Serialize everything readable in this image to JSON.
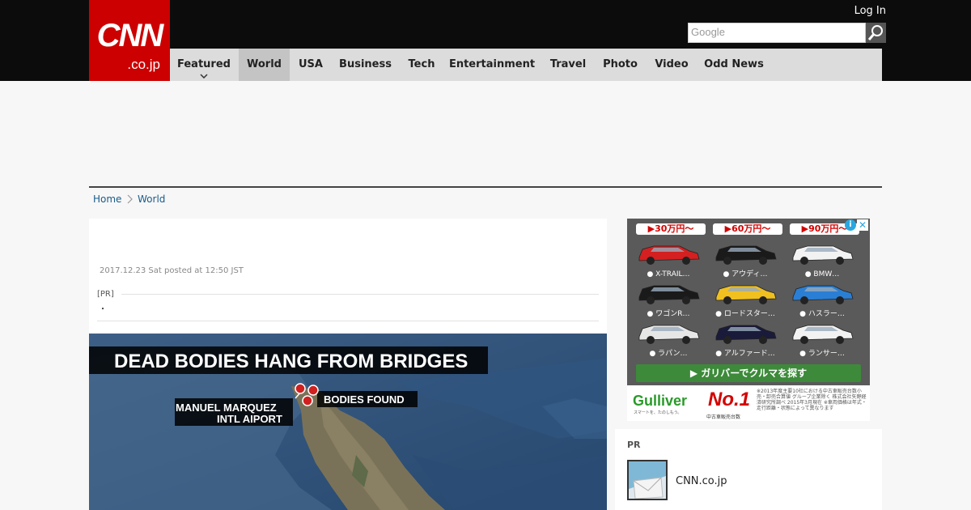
{
  "header": {
    "logo_main": "CNN",
    "logo_sub": ".co.jp",
    "login": "Log In",
    "search_placeholder": "Google"
  },
  "nav": {
    "items": [
      {
        "label": "Featured",
        "active": false,
        "dropdown": true
      },
      {
        "label": "World",
        "active": true
      },
      {
        "label": "USA"
      },
      {
        "label": "Business"
      },
      {
        "label": "Tech"
      },
      {
        "label": "Entertainment"
      },
      {
        "label": "Travel"
      },
      {
        "label": "Photo"
      },
      {
        "label": "Video"
      },
      {
        "label": "Odd News"
      }
    ]
  },
  "breadcrumb": {
    "items": [
      "Home",
      "World"
    ]
  },
  "article": {
    "date": "2017.12.23 Sat posted at 12:50 JST",
    "pr_label": "[PR]",
    "pr_text": "・",
    "image": {
      "headline": "DEAD BODIES HANG FROM BRIDGES",
      "label_airport": "MANUEL MARQUEZ\nINTL AIPORT",
      "label_airport_line1": "MANUEL MARQUEZ",
      "label_airport_line2": "INTL AIPORT",
      "label_found": "BODIES FOUND"
    }
  },
  "ad": {
    "price_tabs": [
      "▶30万円〜",
      "▶60万円〜",
      "▶90万円〜"
    ],
    "cars": [
      {
        "label": "X-TRAIL…",
        "color": "#d42020"
      },
      {
        "label": "アウディ…",
        "color": "#1a1a1a"
      },
      {
        "label": "BMW…",
        "color": "#f2f2f2"
      },
      {
        "label": "ワゴンR…",
        "color": "#1a1a1a"
      },
      {
        "label": "ロードスター…",
        "color": "#f0c020"
      },
      {
        "label": "ハスラー…",
        "color": "#2a7fd4"
      },
      {
        "label": "ラパン…",
        "color": "#e6e6e6"
      },
      {
        "label": "アルファード…",
        "color": "#1a1a3a"
      },
      {
        "label": "ランサー…",
        "color": "#f2f2f2"
      }
    ],
    "cta": "▶ ガリバーでクルマを探す",
    "brand": "Gulliver",
    "brand_sub": "スマートを、たのしもう。",
    "no1": "No.1",
    "no1_sub": "中古車販売台数",
    "fine_print": "※2013年度主要10社における中古車販売台数小売・卸売合算値 グループ企業除く 株式会社矢野経済研究所調べ 2015年3月現在 ※車両価格は年式・走行距離・状態によって異なります"
  },
  "pr_box": {
    "title": "PR",
    "site": "CNN.co.jp"
  },
  "colors": {
    "brand_red": "#cc0000",
    "topbar": "#0c0c0c",
    "nav_bg": "#dcdcdc",
    "link": "#1a5b8a",
    "ad_green": "#3d8a3a"
  }
}
